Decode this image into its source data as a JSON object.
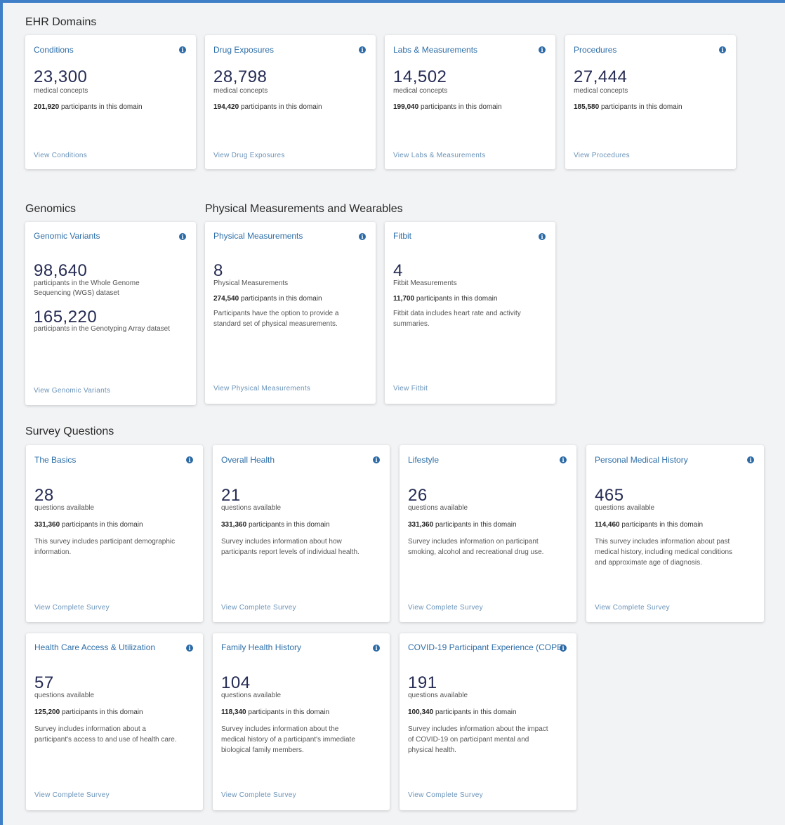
{
  "sections": {
    "ehr": "EHR Domains",
    "genomics": "Genomics",
    "pmw": "Physical Measurements and Wearables",
    "survey": "Survey Questions"
  },
  "ehr_cards": [
    {
      "title": "Conditions",
      "count": "23,300",
      "unit": "medical concepts",
      "participants": "201,920",
      "participants_suffix": "participants in this domain",
      "link": "View Conditions"
    },
    {
      "title": "Drug Exposures",
      "count": "28,798",
      "unit": "medical concepts",
      "participants": "194,420",
      "participants_suffix": "participants in this domain",
      "link": "View Drug Exposures"
    },
    {
      "title": "Labs & Measurements",
      "count": "14,502",
      "unit": "medical concepts",
      "participants": "199,040",
      "participants_suffix": "participants in this domain",
      "link": "View Labs & Measurements"
    },
    {
      "title": "Procedures",
      "count": "27,444",
      "unit": "medical concepts",
      "participants": "185,580",
      "participants_suffix": "participants in this domain",
      "link": "View Procedures"
    }
  ],
  "genomics_card": {
    "title": "Genomic Variants",
    "count1": "98,640",
    "desc1_line1": "participants in the Whole Genome",
    "desc1_line2": "Sequencing (WGS) dataset",
    "count2": "165,220",
    "desc2": "participants in the Genotyping Array dataset",
    "link": "View Genomic Variants"
  },
  "pm_cards": [
    {
      "title": "Physical Measurements",
      "count": "8",
      "unit": "Physical Measurements",
      "participants": "274,540",
      "participants_suffix": "participants in this domain",
      "desc_line1": "Participants have the option to provide a",
      "desc_line2": "standard set of physical measurements.",
      "link": "View Physical Measurements"
    },
    {
      "title": "Fitbit",
      "count": "4",
      "unit": "Fitbit Measurements",
      "participants": "11,700",
      "participants_suffix": "participants in this domain",
      "desc_line1": "Fitbit data includes heart rate and activity",
      "desc_line2": "summaries.",
      "link": "View Fitbit"
    }
  ],
  "survey_cards": [
    {
      "title": "The Basics",
      "count": "28",
      "unit": "questions available",
      "participants": "331,360",
      "participants_suffix": "participants in this domain",
      "desc": [
        "This survey includes participant demographic",
        "information."
      ],
      "link": "View Complete Survey"
    },
    {
      "title": "Overall Health",
      "count": "21",
      "unit": "questions available",
      "participants": "331,360",
      "participants_suffix": "participants in this domain",
      "desc": [
        "Survey includes information about how",
        "participants report levels of individual health."
      ],
      "link": "View Complete Survey"
    },
    {
      "title": "Lifestyle",
      "count": "26",
      "unit": "questions available",
      "participants": "331,360",
      "participants_suffix": "participants in this domain",
      "desc": [
        "Survey includes information on participant",
        "smoking, alcohol and recreational drug use."
      ],
      "link": "View Complete Survey"
    },
    {
      "title": "Personal Medical History",
      "count": "465",
      "unit": "questions available",
      "participants": "114,460",
      "participants_suffix": "participants in this domain",
      "desc": [
        "This survey includes information about past",
        "medical history, including medical conditions",
        "and approximate age of diagnosis."
      ],
      "link": "View Complete Survey"
    },
    {
      "title": "Health Care Access & Utilization",
      "count": "57",
      "unit": "questions available",
      "participants": "125,200",
      "participants_suffix": "participants in this domain",
      "desc": [
        "Survey includes information about a",
        "participant's access to and use of health care."
      ],
      "link": "View Complete Survey"
    },
    {
      "title": "Family Health History",
      "count": "104",
      "unit": "questions available",
      "participants": "118,340",
      "participants_suffix": "participants in this domain",
      "desc": [
        "Survey includes information about the",
        "medical history of a participant's immediate",
        "biological family members."
      ],
      "link": "View Complete Survey"
    },
    {
      "title": "COVID-19 Participant Experience (COPE)",
      "count": "191",
      "unit": "questions available",
      "participants": "100,340",
      "participants_suffix": "participants in this domain",
      "desc": [
        "Survey includes information about the impact",
        "of COVID-19 on participant mental and",
        "physical health."
      ],
      "link": "View Complete Survey"
    }
  ],
  "icons": {
    "info": "info-icon"
  },
  "colors": {
    "accent": "#2f6fa8",
    "number": "#262c54",
    "link": "#6a93b8",
    "frame": "#3f7fc7"
  }
}
